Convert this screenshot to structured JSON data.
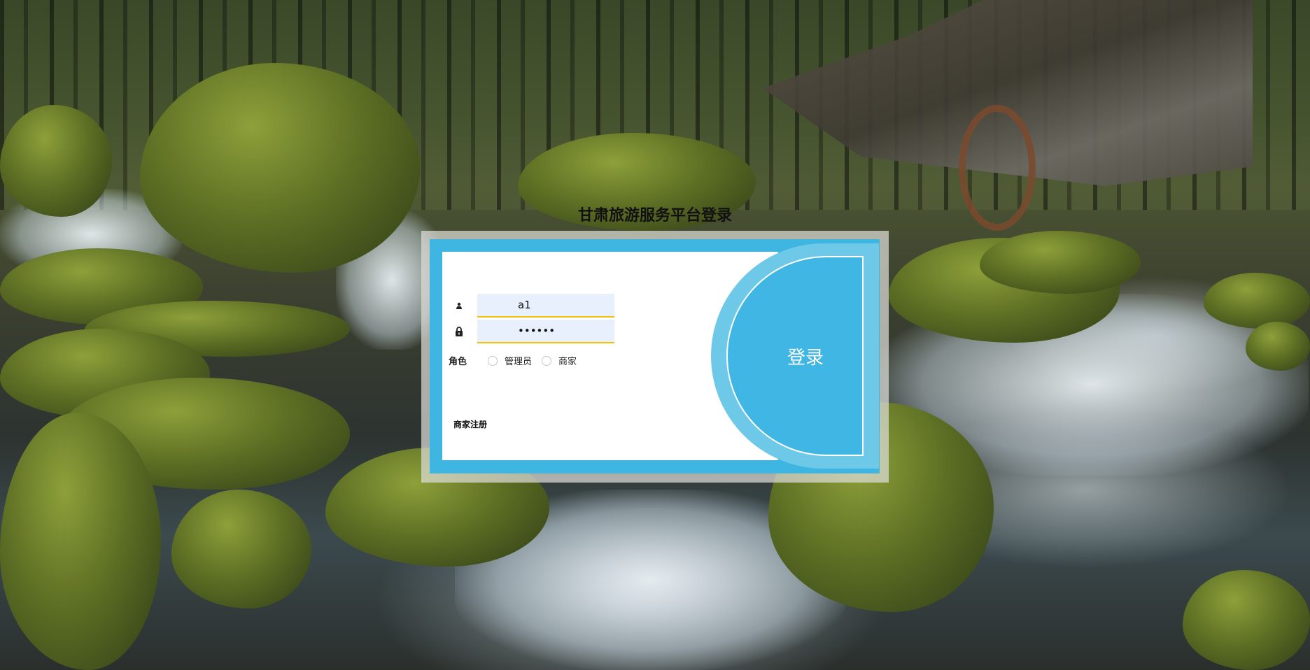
{
  "page": {
    "title": "甘肃旅游服务平台登录"
  },
  "login_form": {
    "username": {
      "value": "a1",
      "icon": "user-icon"
    },
    "password": {
      "value": "••••••",
      "icon": "lock-icon"
    },
    "role": {
      "label": "角色",
      "options": [
        "管理员",
        "商家"
      ]
    },
    "login_button_label": "登录",
    "register_link_label": "商家注册"
  },
  "colors": {
    "accent_blue": "#40b6e4",
    "input_underline": "#f2c200",
    "input_fill": "#e8f0fe"
  }
}
